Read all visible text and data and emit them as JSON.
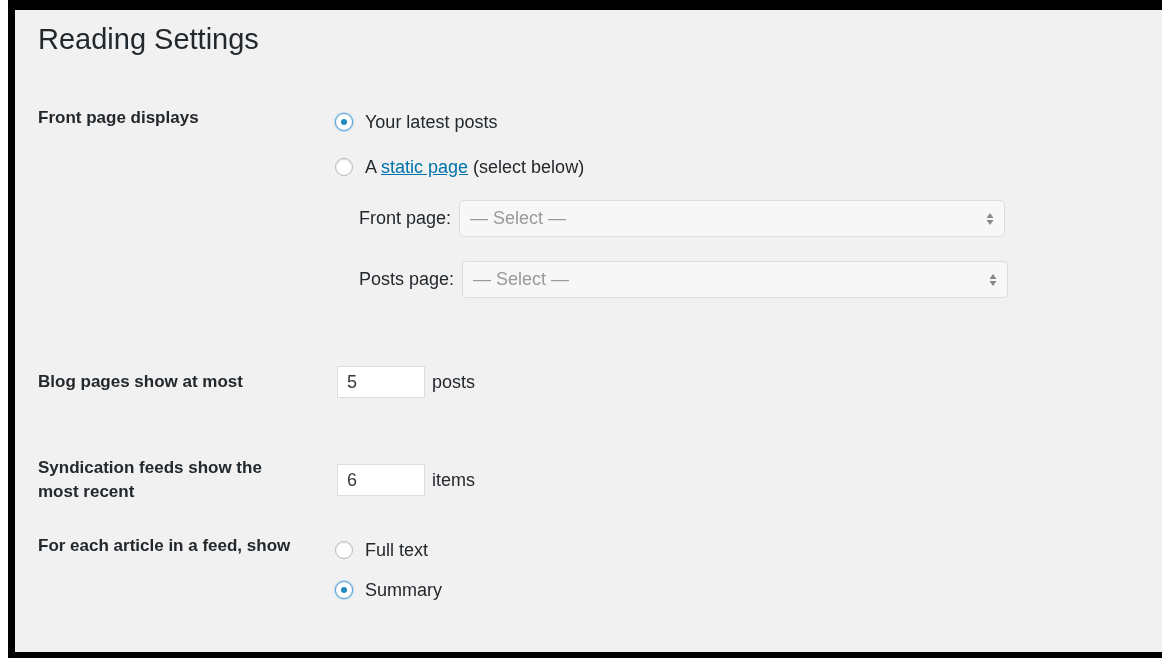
{
  "title": "Reading Settings",
  "rows": [
    {
      "kind": "radios",
      "label": "Front page displays",
      "options": [
        {
          "text": "Your latest posts",
          "selected": true
        },
        {
          "text": "A ",
          "link": "static page",
          "after": " (select below)",
          "selected": false
        }
      ],
      "selects": [
        {
          "label": "Front page:",
          "placeholder": "— Select —"
        },
        {
          "label": "Posts page:",
          "placeholder": "— Select —"
        }
      ]
    },
    {
      "kind": "number",
      "label": "Blog pages show at most",
      "value": "5",
      "unit": "posts"
    },
    {
      "kind": "number",
      "label": "Syndication feeds show the most recent",
      "value": "6",
      "unit": "items"
    },
    {
      "kind": "radios",
      "label": "For each article in a feed, show",
      "options": [
        {
          "text": "Full text",
          "selected": false
        },
        {
          "text": "Summary",
          "selected": true
        }
      ]
    }
  ]
}
